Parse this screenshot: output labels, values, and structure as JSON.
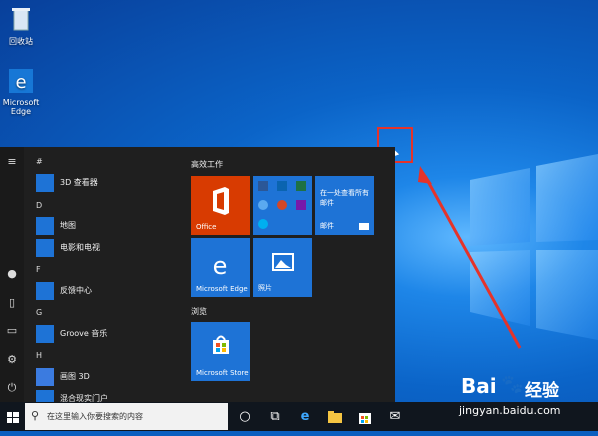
{
  "desktop": {
    "icons": [
      {
        "label": "回收站",
        "icon": "recycle-bin-icon"
      },
      {
        "label": "Microsoft Edge",
        "icon": "edge-icon"
      }
    ]
  },
  "start_menu": {
    "rail": [
      "hamburger-icon",
      "user-icon",
      "document-icon",
      "pictures-icon",
      "settings-icon",
      "power-icon"
    ],
    "sections": [
      {
        "letter": "#",
        "apps": [
          {
            "label": "3D 查看器",
            "icon": "3d-viewer-icon"
          }
        ]
      },
      {
        "letter": "D",
        "apps": [
          {
            "label": "地图",
            "icon": "maps-icon"
          },
          {
            "label": "电影和电视",
            "icon": "movies-tv-icon"
          }
        ]
      },
      {
        "letter": "F",
        "apps": [
          {
            "label": "反馈中心",
            "icon": "feedback-hub-icon"
          }
        ]
      },
      {
        "letter": "G",
        "apps": [
          {
            "label": "Groove 音乐",
            "icon": "groove-music-icon"
          }
        ]
      },
      {
        "letter": "H",
        "apps": [
          {
            "label": "画图 3D",
            "icon": "paint-3d-icon"
          },
          {
            "label": "混合现实门户",
            "icon": "mixed-reality-icon"
          }
        ]
      }
    ],
    "groups": {
      "productivity": {
        "title": "高效工作",
        "tiles": {
          "office": "Office",
          "mail_text": "在一处查看所有邮件",
          "mail_label": "邮件",
          "edge": "Microsoft Edge",
          "photos": "照片"
        }
      },
      "browse": {
        "title": "浏览",
        "tiles": {
          "store": "Microsoft Store"
        }
      }
    }
  },
  "taskbar": {
    "search_placeholder": "在这里输入你要搜索的内容",
    "pinned": [
      "cortana-icon",
      "task-view-icon",
      "edge-icon",
      "file-explorer-icon",
      "store-icon",
      "mail-icon"
    ]
  },
  "watermark": {
    "brand": "Bai",
    "brand2": "经验",
    "url": "jingyan.baidu.com"
  },
  "colors": {
    "office_tile": "#d83b01",
    "tile_blue": "#1e73d6",
    "annotation_red": "#e5332a",
    "taskbar": "#10161e"
  }
}
